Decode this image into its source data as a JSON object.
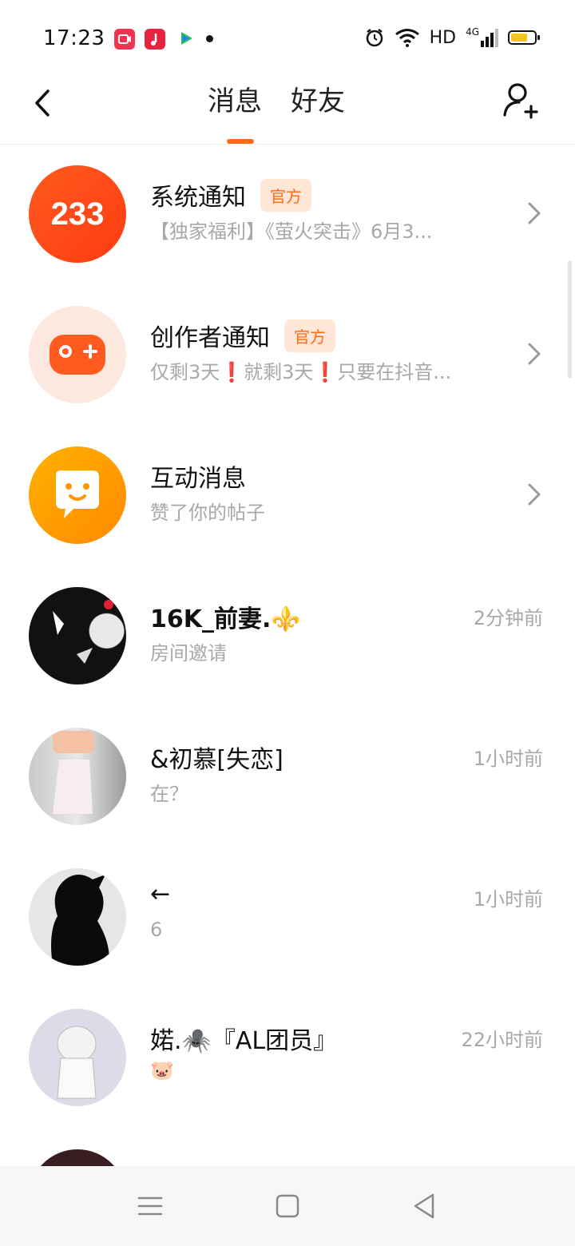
{
  "status_bar": {
    "time": "17:23",
    "network": "HD",
    "cellular": "4G",
    "accent_battery": "#f5c518",
    "app_icons": [
      "screen-recorder-icon",
      "music-app-icon",
      "video-app-icon"
    ]
  },
  "header": {
    "tabs": [
      {
        "label": "消息",
        "active": true
      },
      {
        "label": "好友",
        "active": false
      }
    ],
    "accent": "#ff6a13"
  },
  "messages": [
    {
      "name": "系统通知",
      "badge": "官方",
      "preview": "【独家福利】《萤火突击》6月3...",
      "arrow": true,
      "avatar": "233-logo",
      "avatar_text": "233"
    },
    {
      "name": "创作者通知",
      "badge": "官方",
      "preview": "仅剩3天❗就剩3天❗只要在抖音...",
      "arrow": true,
      "avatar": "gamepad-icon"
    },
    {
      "name": "互动消息",
      "preview": "赞了你的帖子",
      "arrow": true,
      "avatar": "chat-bubble-icon"
    },
    {
      "name": "16K_前妻.⚜️",
      "preview": "房间邀请",
      "time": "2分钟前",
      "avatar": "user-avatar"
    },
    {
      "name": "&初慕[失恋]",
      "preview": "在？",
      "time": "1小时前",
      "avatar": "user-avatar"
    },
    {
      "name": "←",
      "preview": "6",
      "time": "1小时前",
      "avatar": "user-avatar"
    },
    {
      "name": "婼.🕷️『AL团员』",
      "preview": "🐷",
      "time": "22小时前",
      "avatar": "user-avatar"
    }
  ],
  "nav": [
    "menu-icon",
    "home-square-icon",
    "back-triangle-icon"
  ]
}
